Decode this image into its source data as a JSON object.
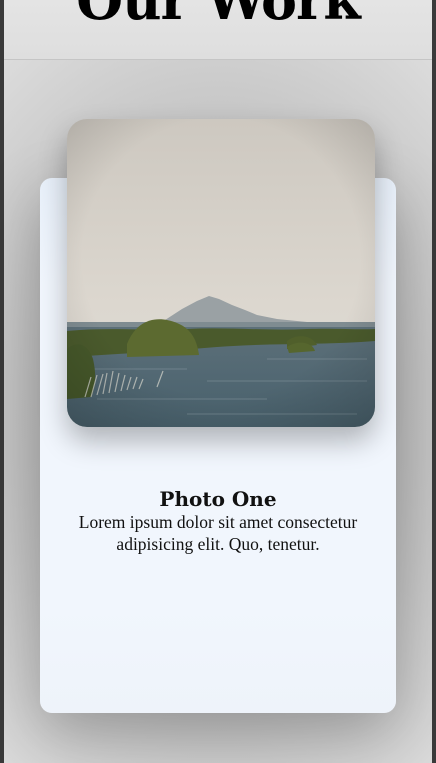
{
  "header": {
    "title": "Our Work"
  },
  "card": {
    "image_alt": "Landscape photo of a lake with reeds and a distant mountain",
    "title": "Photo One",
    "description": "Lorem ipsum dolor sit amet consectetur adipisicing elit. Quo, tenetur."
  },
  "colors": {
    "card_background": "#f1f6fd",
    "page_background": "#b9b9b9",
    "sky": "#d9d4cc",
    "water": "#4f6570",
    "reeds": "#4b5a2a"
  }
}
